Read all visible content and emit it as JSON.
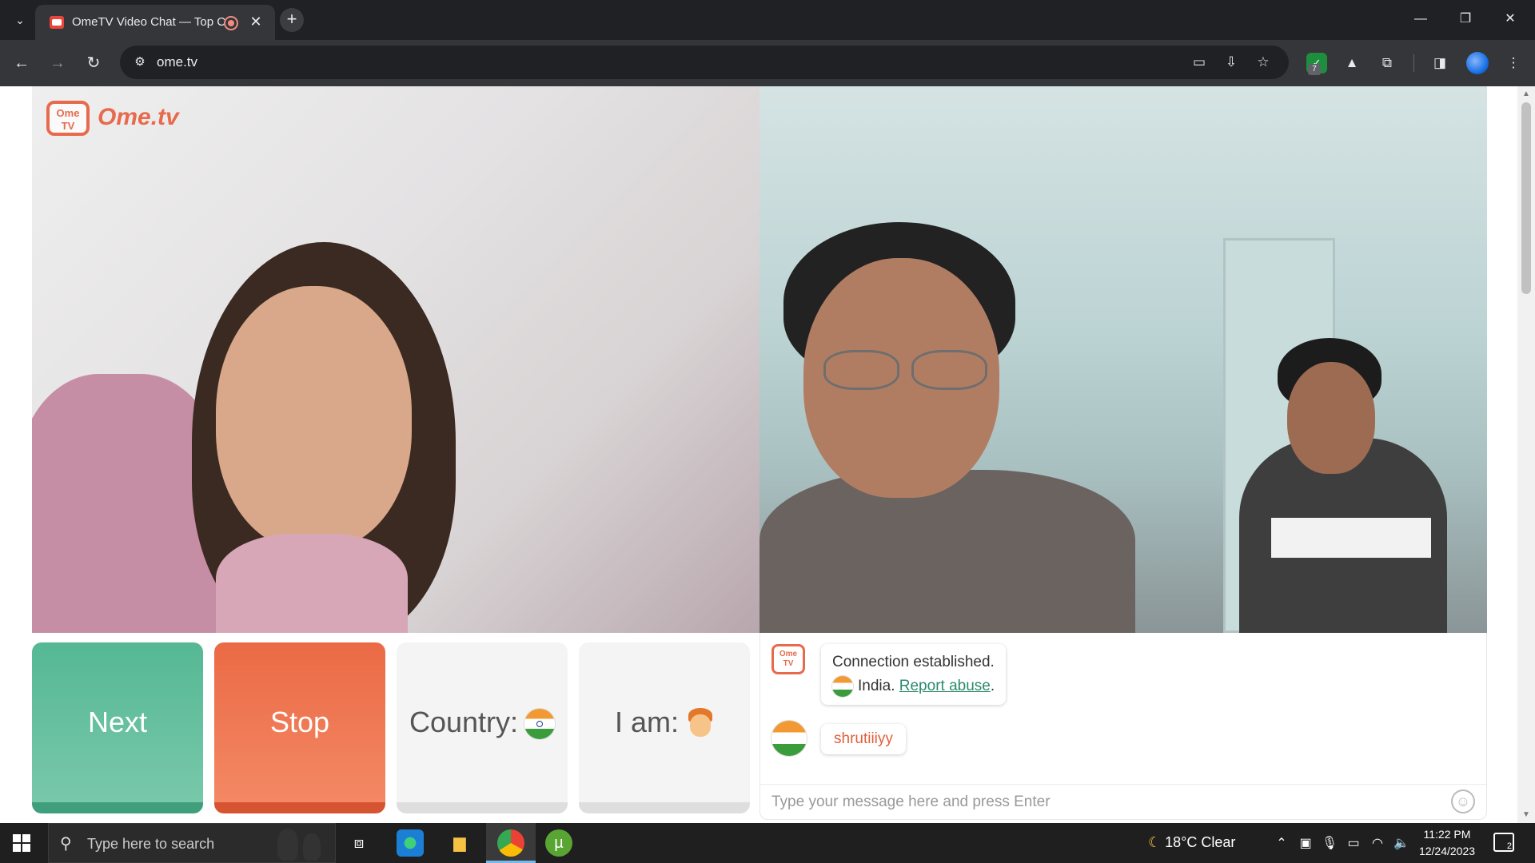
{
  "browser": {
    "tab_title": "OmeTV Video Chat — Top C",
    "tab_close": "✕",
    "new_tab": "+",
    "url": "ome.tv",
    "extension_badge": "7",
    "window": {
      "minimize": "—",
      "restore": "❐",
      "close": "✕"
    }
  },
  "video": {
    "logo_tv": "Ome TV",
    "logo_text": "Ome.tv"
  },
  "controls": {
    "next_label": "Next",
    "stop_label": "Stop",
    "country_label": "Country:",
    "iam_label": "I am:"
  },
  "chat": {
    "logo": "Ome TV",
    "system_message": "Connection established.",
    "country_name": "India.",
    "report_abuse": "Report abuse",
    "report_suffix": ".",
    "peer_username": "shrutiiiyy",
    "input_placeholder": "Type your message here and press Enter"
  },
  "taskbar": {
    "search_placeholder": "Type here to search",
    "weather": "18°C  Clear",
    "time": "11:22 PM",
    "date": "12/24/2023",
    "notification_count": "2"
  },
  "colors": {
    "next": "#55b894",
    "stop": "#ea6a45",
    "brand": "#e86a4d",
    "link": "#2b8a6e"
  }
}
